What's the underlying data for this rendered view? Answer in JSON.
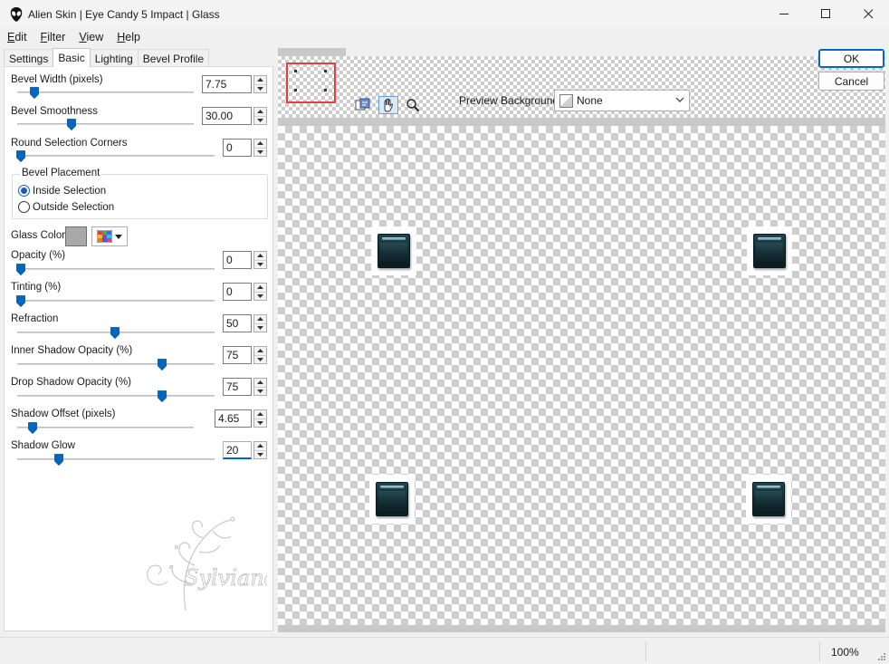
{
  "window": {
    "title": "Alien Skin | Eye Candy 5 Impact | Glass"
  },
  "menu": [
    {
      "u": "E",
      "rest": "dit"
    },
    {
      "u": "F",
      "rest": "ilter"
    },
    {
      "u": "V",
      "rest": "iew"
    },
    {
      "u": "H",
      "rest": "elp"
    }
  ],
  "tabs": [
    "Settings",
    "Basic",
    "Lighting",
    "Bevel Profile"
  ],
  "controls": {
    "bevel_width": {
      "label": "Bevel Width (pixels)",
      "value": "7.75",
      "level": 0.08
    },
    "bevel_smoothness": {
      "label": "Bevel Smoothness",
      "value": "30.00",
      "level": 0.3
    },
    "round_corners": {
      "label": "Round Selection Corners",
      "value": "0",
      "level": 0.0
    },
    "opacity": {
      "label": "Opacity (%)",
      "value": "0",
      "level": 0.0
    },
    "tinting": {
      "label": "Tinting (%)",
      "value": "0",
      "level": 0.0
    },
    "refraction": {
      "label": "Refraction",
      "value": "50",
      "level": 0.5
    },
    "inner_shadow": {
      "label": "Inner Shadow Opacity (%)",
      "value": "75",
      "level": 0.75
    },
    "drop_shadow": {
      "label": "Drop Shadow Opacity (%)",
      "value": "75",
      "level": 0.75
    },
    "shadow_offset": {
      "label": "Shadow Offset (pixels)",
      "value": "4.65",
      "level": 0.07
    },
    "shadow_glow": {
      "label": "Shadow Glow",
      "value": "20",
      "level": 0.2
    }
  },
  "bevel_placement": {
    "title": "Bevel Placement",
    "inside": "Inside Selection",
    "outside": "Outside Selection",
    "selected": "inside"
  },
  "glass_color": {
    "label": "Glass Color",
    "color": "#a9a9a9"
  },
  "preview_background": {
    "label": "Preview Background:",
    "value": "None"
  },
  "buttons": {
    "ok": "OK",
    "cancel": "Cancel"
  },
  "status": {
    "zoom": "100%"
  },
  "colors": {
    "accent": "#0067c0",
    "glass_fill": "#0e2a32",
    "navigator_border": "#e8403e"
  }
}
